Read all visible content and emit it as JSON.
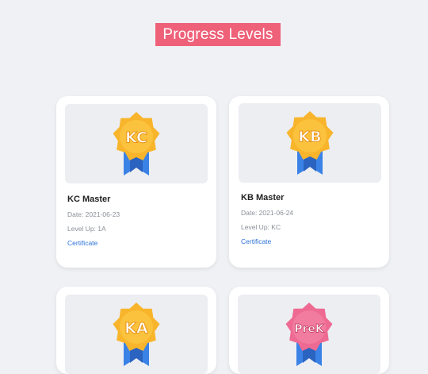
{
  "header": {
    "title": "Progress Levels"
  },
  "colors": {
    "accent": "#ee6179",
    "badge_gold": "#f8b52c",
    "badge_pink": "#ee6a92",
    "ribbon_blue": "#3b82e6",
    "link_blue": "#2d72d9"
  },
  "cards": [
    {
      "badge_text": "KC",
      "badge_icon": "gold-award-badge-icon",
      "title": "KC Master",
      "date": "Date: 2021-06-23",
      "level_up": "Level Up: 1A",
      "link": "Certificate"
    },
    {
      "badge_text": "KB",
      "badge_icon": "gold-award-badge-icon",
      "title": "KB Master",
      "date": "Date: 2021-06-24",
      "level_up": "Level Up: KC",
      "link": "Certificate"
    },
    {
      "badge_text": "KA",
      "badge_icon": "gold-award-badge-icon"
    },
    {
      "badge_text": "PreK",
      "badge_icon": "pink-award-badge-icon"
    }
  ]
}
